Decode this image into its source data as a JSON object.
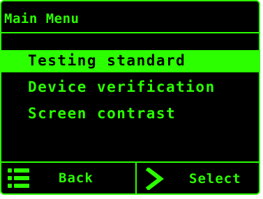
{
  "header": {
    "title": "Main Menu"
  },
  "menu": {
    "items": [
      {
        "label": "Testing standard",
        "selected": true
      },
      {
        "label": "Device verification",
        "selected": false
      },
      {
        "label": "Screen contrast",
        "selected": false
      }
    ]
  },
  "softkeys": {
    "left": {
      "label": "Back",
      "icon": "list-icon"
    },
    "right": {
      "label": "Select",
      "icon": "chevron-right-icon"
    }
  },
  "colors": {
    "accent": "#2bff00",
    "background": "#000000",
    "selected_text": "#000000"
  }
}
